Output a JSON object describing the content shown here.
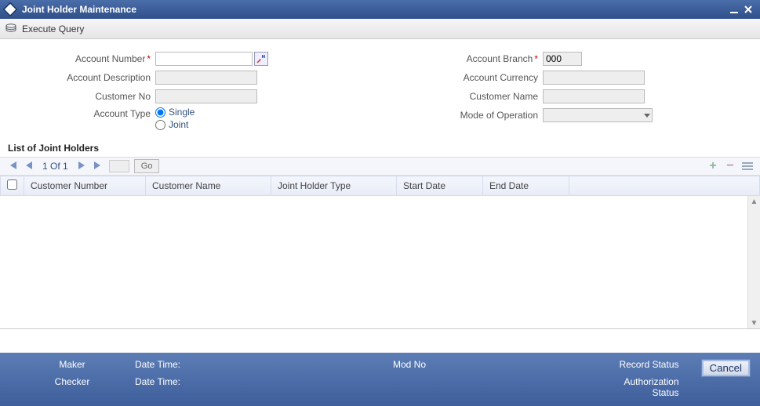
{
  "titlebar": {
    "title": "Joint Holder Maintenance"
  },
  "toolbar": {
    "execute_query": "Execute Query"
  },
  "form": {
    "left": {
      "account_number_label": "Account Number",
      "account_number_value": "",
      "account_description_label": "Account Description",
      "account_description_value": "",
      "customer_no_label": "Customer No",
      "customer_no_value": "",
      "account_type_label": "Account Type",
      "account_type_options": {
        "single": "Single",
        "joint": "Joint"
      }
    },
    "right": {
      "account_branch_label": "Account Branch",
      "account_branch_value": "000",
      "account_currency_label": "Account Currency",
      "account_currency_value": "",
      "customer_name_label": "Customer Name",
      "customer_name_value": "",
      "mode_of_operation_label": "Mode of Operation",
      "mode_of_operation_value": ""
    }
  },
  "list": {
    "section_title": "List of Joint Holders",
    "pager": {
      "position": "1 Of 1",
      "go_label": "Go"
    },
    "columns": {
      "customer_number": "Customer Number",
      "customer_name": "Customer Name",
      "joint_holder_type": "Joint Holder Type",
      "start_date": "Start Date",
      "end_date": "End Date"
    }
  },
  "footer": {
    "maker": "Maker",
    "checker": "Checker",
    "date_time": "Date Time:",
    "mod_no": "Mod No",
    "record_status": "Record Status",
    "authorization_status": "Authorization Status",
    "cancel": "Cancel"
  }
}
